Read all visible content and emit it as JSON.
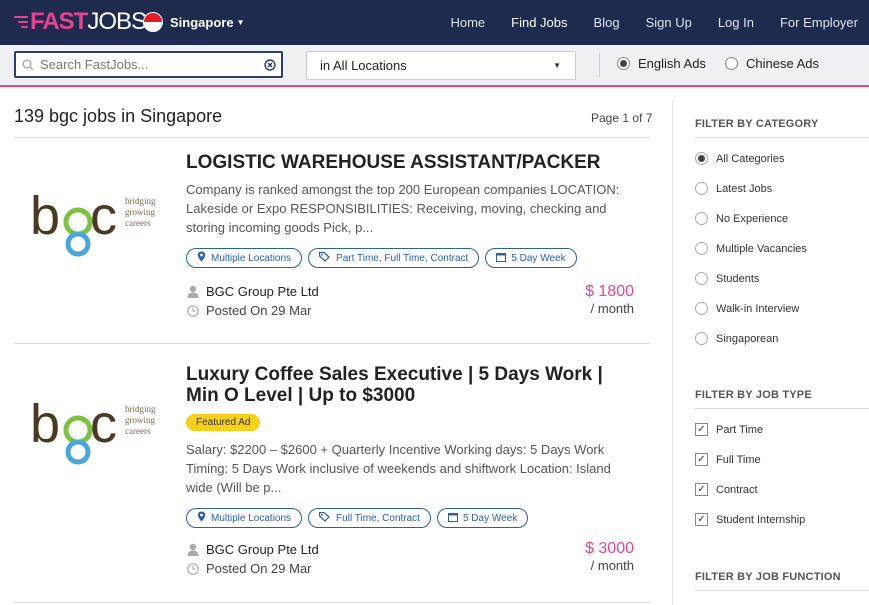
{
  "nav": {
    "logo_fast": "FAST",
    "logo_jobs": "JOBS",
    "country": "Singapore",
    "links": [
      "Home",
      "Find Jobs",
      "Blog",
      "Sign Up",
      "Log In",
      "For Employer"
    ]
  },
  "search": {
    "placeholder": "Search FastJobs...",
    "location": "in All Locations",
    "ad_options": [
      "English Ads",
      "Chinese Ads"
    ],
    "selected_ad": "English Ads"
  },
  "results": {
    "title": "139 bgc jobs in Singapore",
    "page": "Page 1 of 7"
  },
  "jobs": [
    {
      "title": "LOGISTIC WAREHOUSE ASSISTANT/PACKER",
      "featured": "",
      "description": "Company is ranked amongst the top 200 European companies LOCATION: Lakeside or Expo RESPONSIBILITIES: Receiving, moving, checking and storing incoming goods Pick, p...",
      "tags": [
        "Multiple Locations",
        "Part Time, Full Time, Contract",
        "5 Day Week"
      ],
      "company": "BGC Group Pte Ltd",
      "posted": "Posted On 29 Mar",
      "salary": "$ 1800",
      "salary_period": "/ month",
      "logo_text": "bgc",
      "logo_tag1": "bridging",
      "logo_tag2": "growing",
      "logo_tag3": "careers"
    },
    {
      "title": "Luxury Coffee Sales Executive | 5 Days Work | Min O Level | Up to $3000",
      "featured": "Featured Ad",
      "description": "Salary: $2200 – $2600 + Quarterly Incentive Working days: 5 Days Work Timing: 5 Days Work inclusive of weekends and shiftwork Location: Island wide (Will be p...",
      "tags": [
        "Multiple Locations",
        "Full Time, Contract",
        "5 Day Week"
      ],
      "company": "BGC Group Pte Ltd",
      "posted": "Posted On 29 Mar",
      "salary": "$ 3000",
      "salary_period": "/ month",
      "logo_text": "bgc",
      "logo_tag1": "bridging",
      "logo_tag2": "growing",
      "logo_tag3": "careers"
    }
  ],
  "sidebar": {
    "category_head": "FILTER BY CATEGORY",
    "categories": [
      "All Categories",
      "Latest Jobs",
      "No Experience",
      "Multiple Vacancies",
      "Students",
      "Walk-in Interview",
      "Singaporean"
    ],
    "selected_category": "All Categories",
    "jobtype_head": "FILTER BY JOB TYPE",
    "jobtypes": [
      "Part Time",
      "Full Time",
      "Contract",
      "Student Internship"
    ],
    "function_head": "FILTER BY JOB FUNCTION"
  },
  "colors": {
    "navy": "#1e2a4e",
    "pink": "#e4448f",
    "tag_blue": "#2b5fa8",
    "featured_yellow": "#f7d117"
  }
}
